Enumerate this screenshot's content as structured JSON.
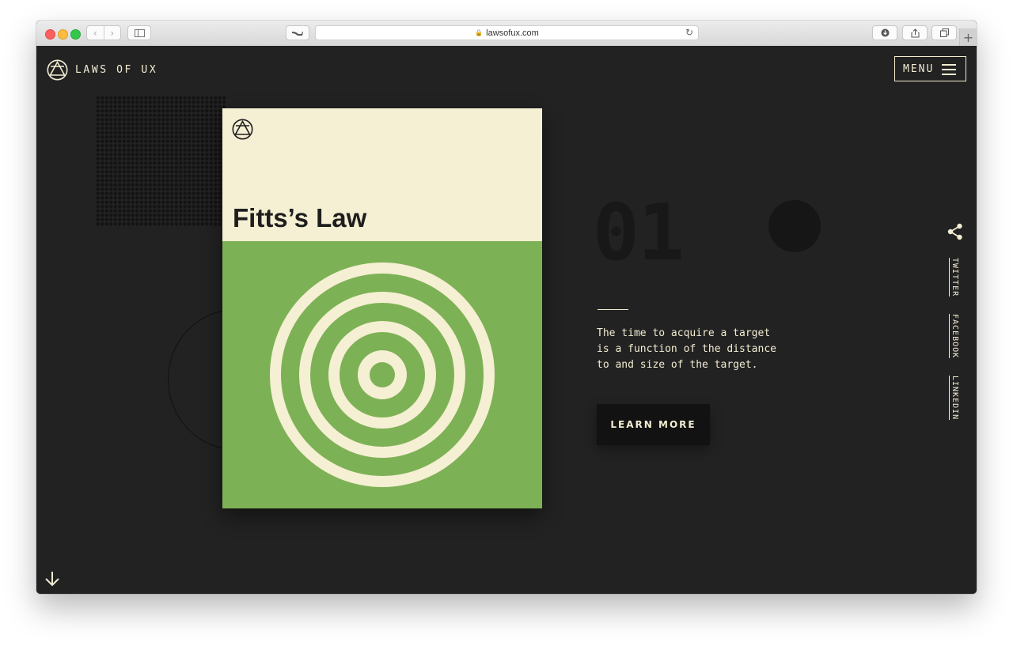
{
  "browser": {
    "url": "lawsofux.com"
  },
  "header": {
    "logo_text": "LAWS OF UX",
    "menu_label": "MENU"
  },
  "card": {
    "title": "Fitts’s Law",
    "top_color": "#f5efd3",
    "bottom_color": "#7db155"
  },
  "law": {
    "number": "01",
    "description": "The time to acquire a target is a function of the distance to and size of the target.",
    "cta_label": "LEARN MORE"
  },
  "social": {
    "links": [
      "TWITTER",
      "FACEBOOK",
      "LINKEDIN"
    ]
  },
  "colors": {
    "background": "#222222",
    "cream": "#f2ecd2",
    "button": "#121212"
  }
}
